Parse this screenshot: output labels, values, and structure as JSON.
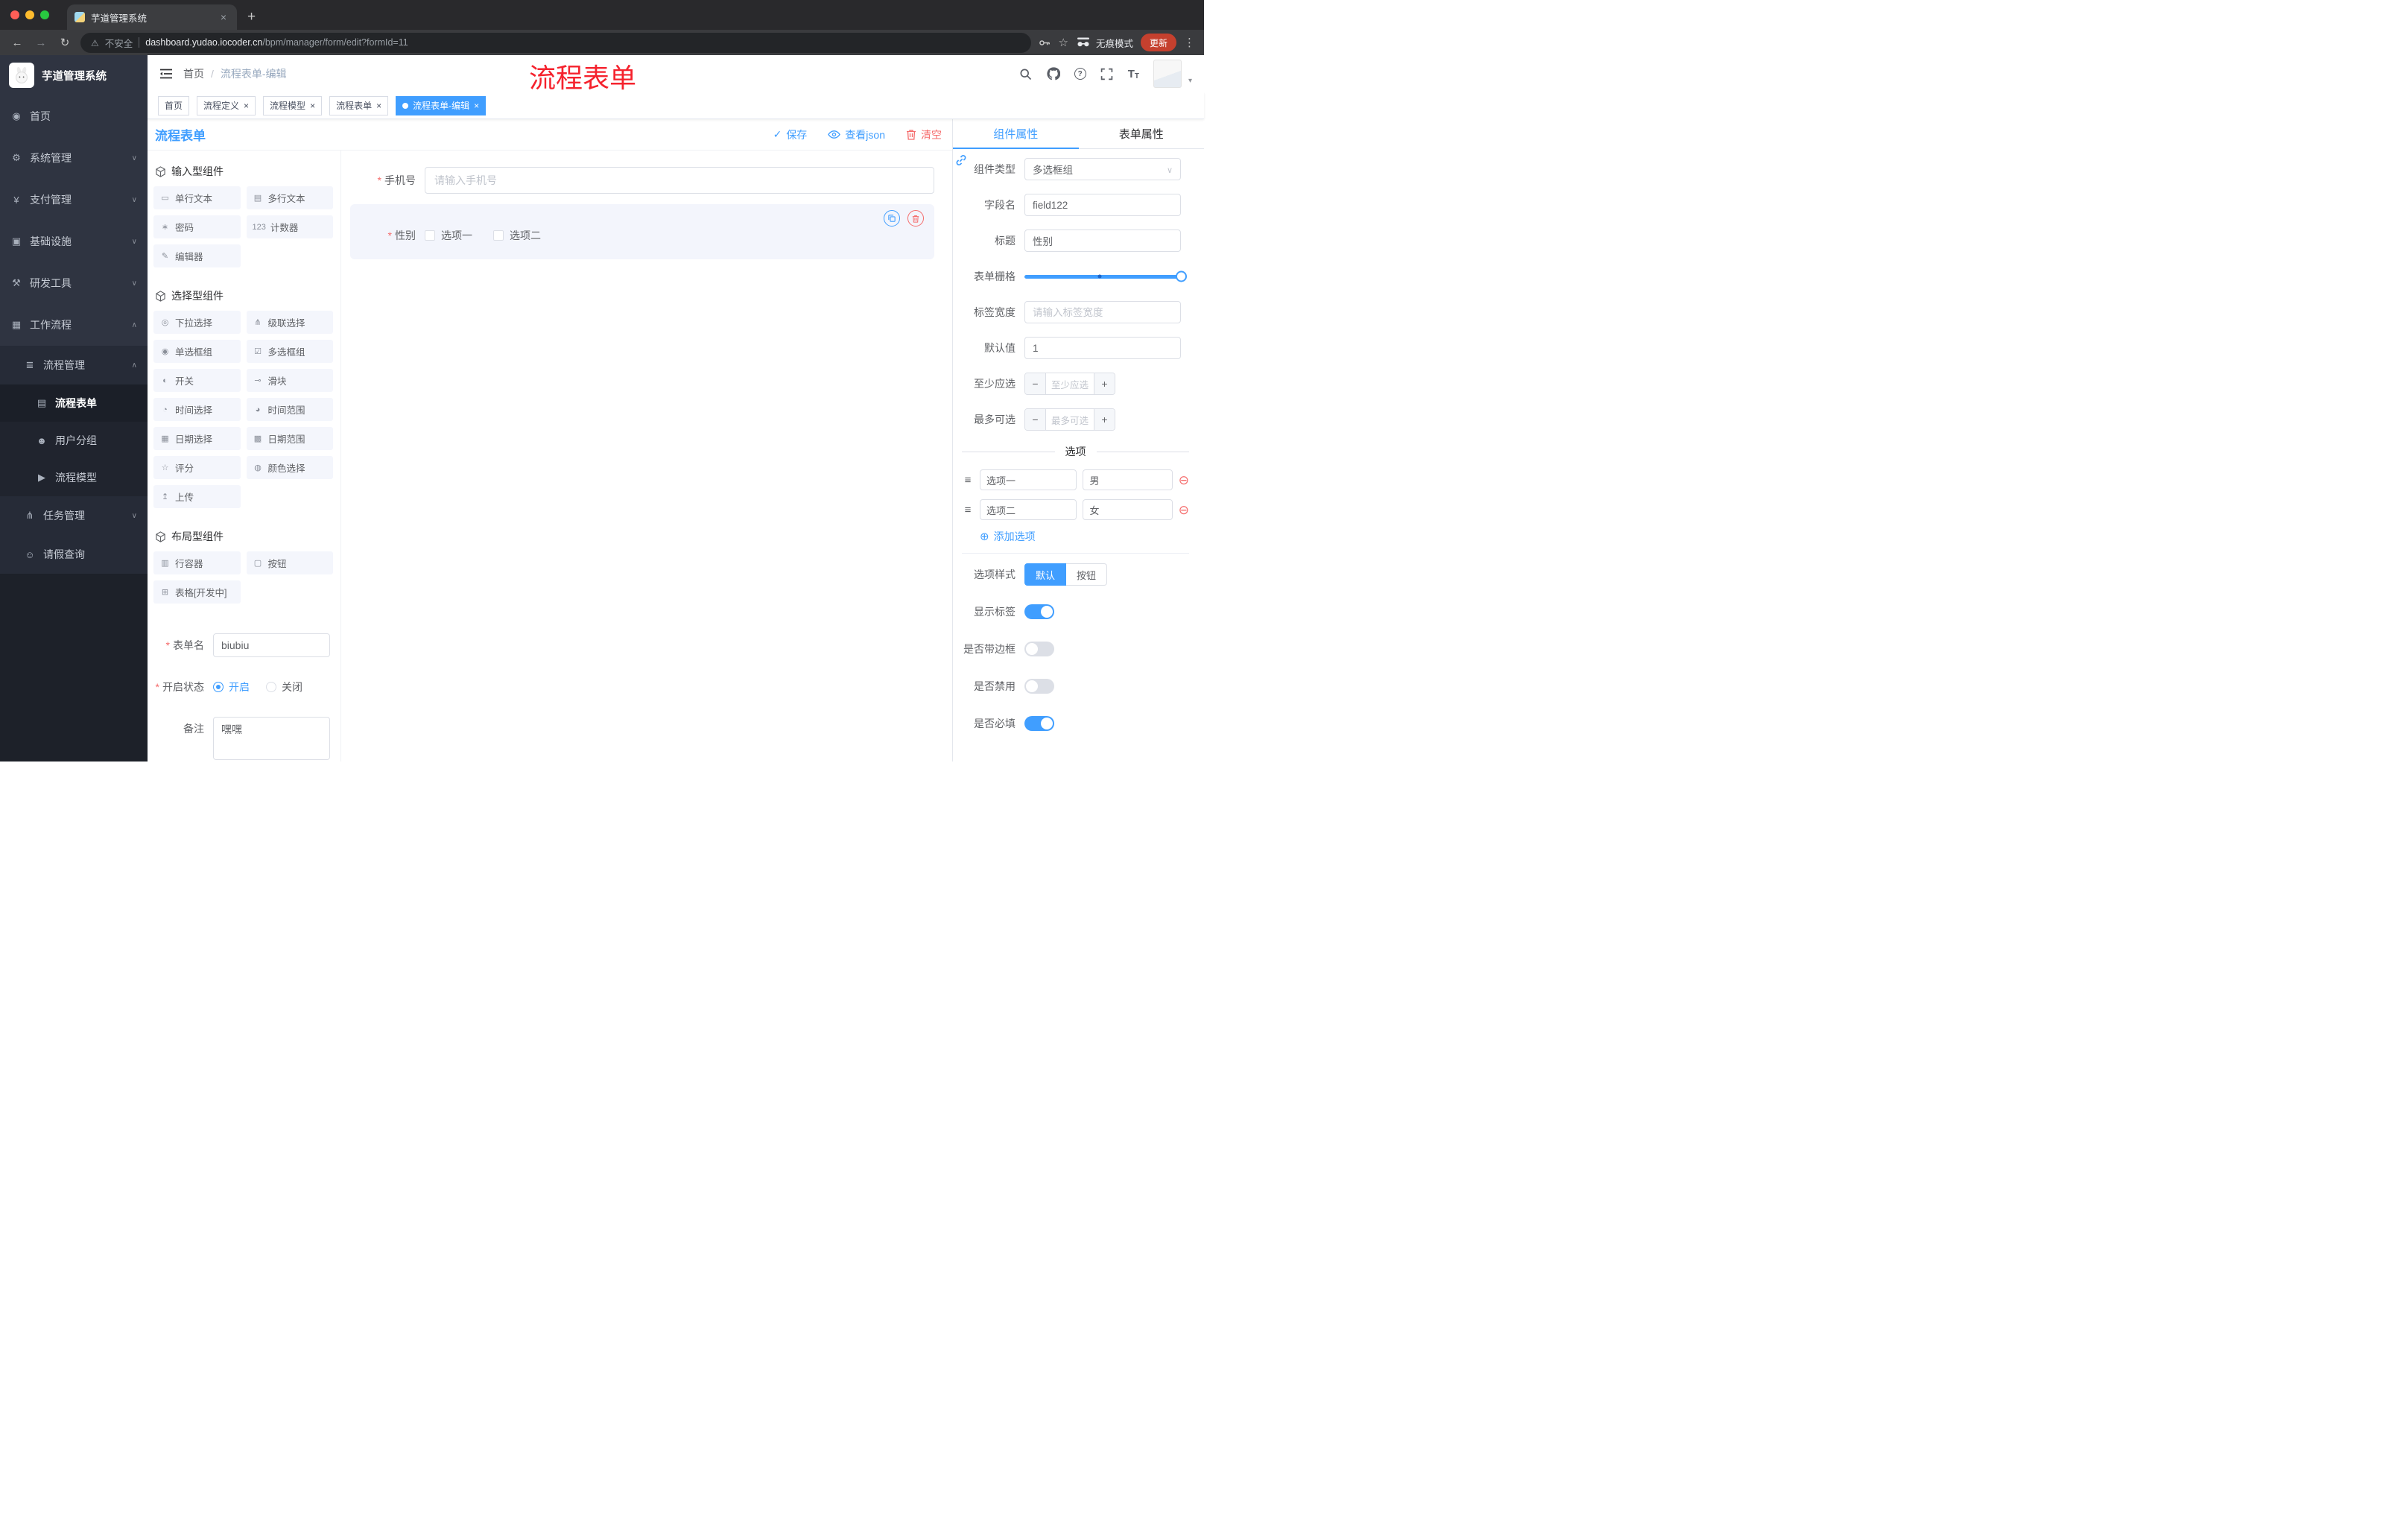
{
  "colors": {
    "primary": "#409eff",
    "danger": "#f56c6c",
    "annotation_red": "#f5222d",
    "active_tag": "#409eff",
    "update_pill": "#c5402e",
    "sidebar_bg": "#2f3441"
  },
  "browser": {
    "tab_title": "芋道管理系统",
    "security_label": "不安全",
    "url_domain": "dashboard.yudao.iocoder.cn",
    "url_path": "/bpm/manager/form/edit?formId=11",
    "incognito_label": "无痕模式",
    "update_label": "更新"
  },
  "sidebar": {
    "app_title": "芋道管理系统",
    "menu": [
      {
        "icon": "dashboard-icon",
        "label": "首页"
      },
      {
        "icon": "gear-icon",
        "label": "系统管理"
      },
      {
        "icon": "yen-icon",
        "label": "支付管理"
      },
      {
        "icon": "monitor-icon",
        "label": "基础设施"
      },
      {
        "icon": "tools-icon",
        "label": "研发工具"
      },
      {
        "icon": "workflow-icon",
        "label": "工作流程",
        "expanded": true
      },
      {
        "icon": "list-icon",
        "label": "流程管理",
        "expanded": true
      },
      {
        "icon": "form-icon",
        "label": "流程表单",
        "active": true
      },
      {
        "icon": "users-icon",
        "label": "用户分组"
      },
      {
        "icon": "send-icon",
        "label": "流程模型"
      },
      {
        "icon": "branch-icon",
        "label": "任务管理"
      },
      {
        "icon": "person-icon",
        "label": "请假查询"
      }
    ]
  },
  "header": {
    "breadcrumb_home": "首页",
    "breadcrumb_current": "流程表单-编辑",
    "annotation": "流程表单"
  },
  "tags": [
    {
      "label": "首页",
      "closable": false,
      "active": false
    },
    {
      "label": "流程定义",
      "closable": true,
      "active": false
    },
    {
      "label": "流程模型",
      "closable": true,
      "active": false
    },
    {
      "label": "流程表单",
      "closable": true,
      "active": false
    },
    {
      "label": "流程表单-编辑",
      "closable": true,
      "active": true
    }
  ],
  "toolbar": {
    "title": "流程表单",
    "save": "保存",
    "view_json": "查看json",
    "clear": "清空"
  },
  "palette": {
    "sections": [
      {
        "title": "输入型组件",
        "items": [
          {
            "icon": "text-field-icon",
            "label": "单行文本"
          },
          {
            "icon": "textarea-icon",
            "label": "多行文本"
          },
          {
            "icon": "password-icon",
            "label": "密码"
          },
          {
            "icon": "counter-icon",
            "label": "计数器"
          },
          {
            "icon": "editor-icon",
            "label": "编辑器"
          }
        ]
      },
      {
        "title": "选择型组件",
        "items": [
          {
            "icon": "select-icon",
            "label": "下拉选择"
          },
          {
            "icon": "cascader-icon",
            "label": "级联选择"
          },
          {
            "icon": "radio-group-icon",
            "label": "单选框组"
          },
          {
            "icon": "checkbox-group-icon",
            "label": "多选框组"
          },
          {
            "icon": "switch-icon",
            "label": "开关"
          },
          {
            "icon": "slider-icon",
            "label": "滑块"
          },
          {
            "icon": "time-icon",
            "label": "时间选择"
          },
          {
            "icon": "time-range-icon",
            "label": "时间范围"
          },
          {
            "icon": "date-icon",
            "label": "日期选择"
          },
          {
            "icon": "date-range-icon",
            "label": "日期范围"
          },
          {
            "icon": "rate-icon",
            "label": "评分"
          },
          {
            "icon": "color-icon",
            "label": "颜色选择"
          },
          {
            "icon": "upload-icon",
            "label": "上传"
          }
        ]
      },
      {
        "title": "布局型组件",
        "items": [
          {
            "icon": "row-icon",
            "label": "行容器"
          },
          {
            "icon": "button-icon",
            "label": "按钮"
          },
          {
            "icon": "table-icon",
            "label": "表格[开发中]"
          }
        ]
      }
    ],
    "form": {
      "name_label": "表单名",
      "name_value": "biubiu",
      "status_label": "开启状态",
      "status_on": "开启",
      "status_off": "关闭",
      "remark_label": "备注",
      "remark_value": "嘿嘿"
    }
  },
  "canvas": {
    "phone_label": "手机号",
    "phone_placeholder": "请输入手机号",
    "gender_label": "性别",
    "gender_option1": "选项一",
    "gender_option2": "选项二"
  },
  "props": {
    "tab_component": "组件属性",
    "tab_form": "表单属性",
    "rows": {
      "type_label": "组件类型",
      "type_value": "多选框组",
      "field_label": "字段名",
      "field_value": "field122",
      "title_label": "标题",
      "title_value": "性别",
      "grid_label": "表单栅格",
      "labelw_label": "标签宽度",
      "labelw_placeholder": "请输入标签宽度",
      "default_label": "默认值",
      "default_value": "1",
      "min_label": "至少应选",
      "min_placeholder": "至少应选",
      "max_label": "最多可选",
      "max_placeholder": "最多可选"
    },
    "options_title": "选项",
    "options": [
      {
        "name": "选项一",
        "value": "男"
      },
      {
        "name": "选项二",
        "value": "女"
      }
    ],
    "add_option": "添加选项",
    "style_label": "选项样式",
    "style_default": "默认",
    "style_button": "按钮",
    "toggles": [
      {
        "label": "显示标签",
        "on": true
      },
      {
        "label": "是否带边框",
        "on": false
      },
      {
        "label": "是否禁用",
        "on": false
      },
      {
        "label": "是否必填",
        "on": true
      }
    ]
  }
}
